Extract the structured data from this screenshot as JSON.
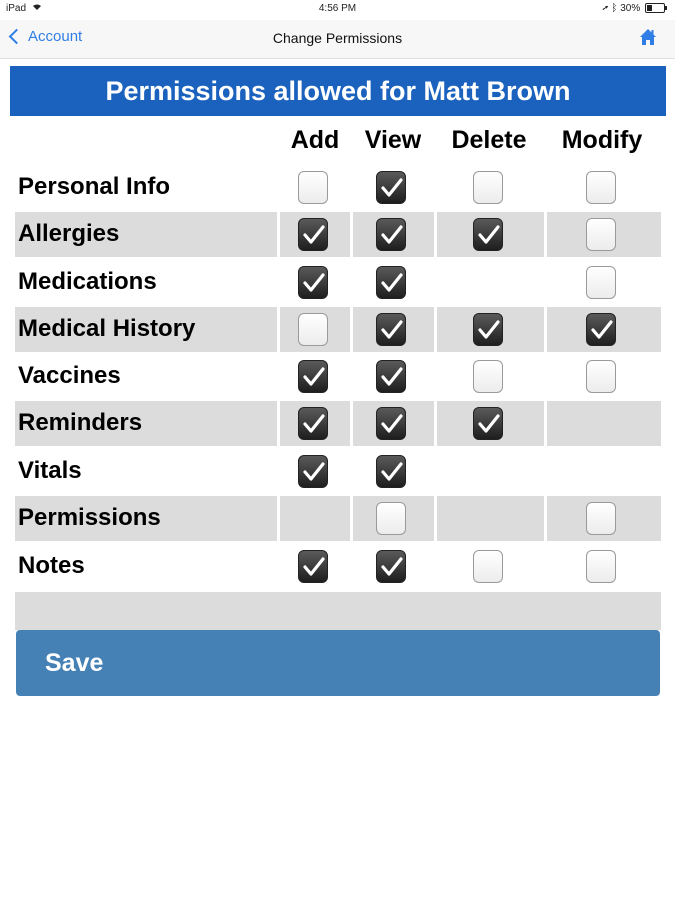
{
  "status_bar": {
    "device": "iPad",
    "time": "4:56 PM",
    "battery": "30%"
  },
  "nav": {
    "back_label": "Account",
    "title": "Change Permissions"
  },
  "banner": {
    "text": "Permissions allowed for Matt Brown"
  },
  "columns": [
    "Add",
    "View",
    "Delete",
    "Modify"
  ],
  "rows": [
    {
      "label": "Personal Info",
      "cells": [
        false,
        true,
        false,
        false
      ]
    },
    {
      "label": "Allergies",
      "cells": [
        true,
        true,
        true,
        false
      ]
    },
    {
      "label": "Medications",
      "cells": [
        true,
        true,
        null,
        false
      ]
    },
    {
      "label": "Medical History",
      "cells": [
        false,
        true,
        true,
        true
      ]
    },
    {
      "label": "Vaccines",
      "cells": [
        true,
        true,
        false,
        false
      ]
    },
    {
      "label": "Reminders",
      "cells": [
        true,
        true,
        true,
        null
      ]
    },
    {
      "label": "Vitals",
      "cells": [
        true,
        true,
        null,
        null
      ]
    },
    {
      "label": "Permissions",
      "cells": [
        null,
        false,
        null,
        false
      ]
    },
    {
      "label": "Notes",
      "cells": [
        true,
        true,
        false,
        false
      ]
    }
  ],
  "save_label": "Save",
  "colors": {
    "banner": "#1a62be",
    "save": "#4681b6",
    "link": "#2f7ee6",
    "stripe": "#dcdcdc"
  }
}
